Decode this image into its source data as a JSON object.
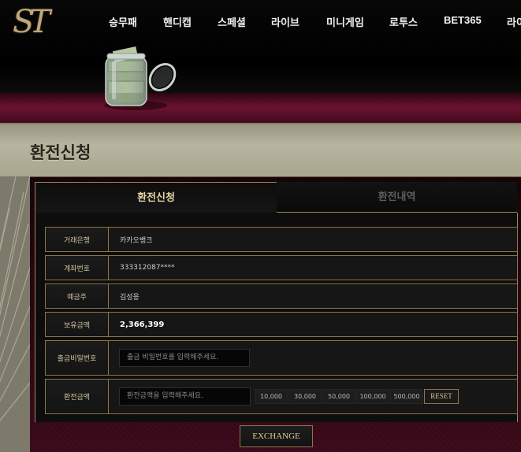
{
  "brand": {
    "logo_text": "ST"
  },
  "nav": {
    "items": [
      {
        "label": "승무패"
      },
      {
        "label": "핸디캡"
      },
      {
        "label": "스페셜"
      },
      {
        "label": "라이브"
      },
      {
        "label": "미니게임"
      },
      {
        "label": "로투스"
      },
      {
        "label": "BET365"
      },
      {
        "label": "라이"
      }
    ]
  },
  "page": {
    "title": "환전신청"
  },
  "tabs": {
    "request": "환전신청",
    "history": "환전내역"
  },
  "form": {
    "bank_label": "거래은행",
    "bank_value": "카카오뱅크",
    "account_label": "계좌번호",
    "account_value": "333312087****",
    "holder_label": "예금주",
    "holder_value": "김성웅",
    "balance_label": "보유금액",
    "balance_value": "2,366,399",
    "password_label": "출금비밀번호",
    "password_placeholder": "출금 비밀번호를 입력해주세요.",
    "amount_label": "환전금액",
    "amount_placeholder": "환전금액을 입력해주세요.",
    "quick_amounts": [
      "10,000",
      "30,000",
      "50,000",
      "100,000",
      "500,000"
    ],
    "reset_label": "RESET",
    "submit_label": "EXCHANGE"
  },
  "colors": {
    "accent_gold": "#a08858",
    "banner_crimson": "#6b1230",
    "title_strip": "#b7b49f"
  }
}
